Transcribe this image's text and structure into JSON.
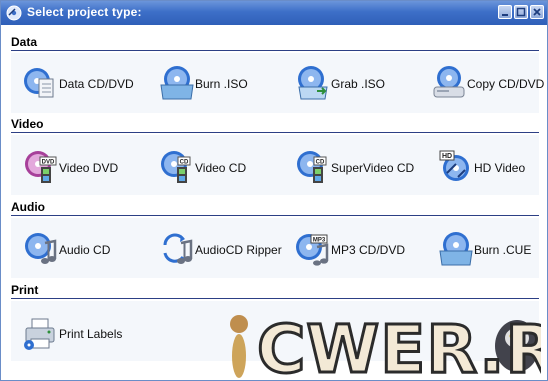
{
  "window": {
    "title": "Select project type:"
  },
  "sections": [
    {
      "title": "Data",
      "items": [
        {
          "label": "Data CD/DVD",
          "icon": "data-cd-icon"
        },
        {
          "label": "Burn .ISO",
          "icon": "burn-iso-icon"
        },
        {
          "label": "Grab .ISO",
          "icon": "grab-iso-icon"
        },
        {
          "label": "Copy CD/DVD",
          "icon": "copy-cd-icon"
        }
      ]
    },
    {
      "title": "Video",
      "items": [
        {
          "label": "Video DVD",
          "icon": "video-dvd-icon"
        },
        {
          "label": "Video CD",
          "icon": "video-cd-icon"
        },
        {
          "label": "SuperVideo CD",
          "icon": "supervideo-cd-icon"
        },
        {
          "label": "HD Video",
          "icon": "hd-video-icon"
        }
      ]
    },
    {
      "title": "Audio",
      "items": [
        {
          "label": "Audio CD",
          "icon": "audio-cd-icon"
        },
        {
          "label": "AudioCD Ripper",
          "icon": "audiocd-ripper-icon"
        },
        {
          "label": "MP3 CD/DVD",
          "icon": "mp3-cd-icon"
        },
        {
          "label": "Burn .CUE",
          "icon": "burn-cue-icon"
        }
      ]
    },
    {
      "title": "Print",
      "items": [
        {
          "label": "Print Labels",
          "icon": "printer-icon"
        }
      ]
    }
  ],
  "icon_badges": {
    "dvd": "DVD",
    "cd": "CD",
    "hd": "HD",
    "mp3": "MP3"
  },
  "watermark": {
    "text": "CWER.RU"
  },
  "colors": {
    "titlebar": "#3d6fc8",
    "section_rule": "#2c3f85",
    "disc": "#2f6fd0",
    "band": "#f4f7fb"
  }
}
